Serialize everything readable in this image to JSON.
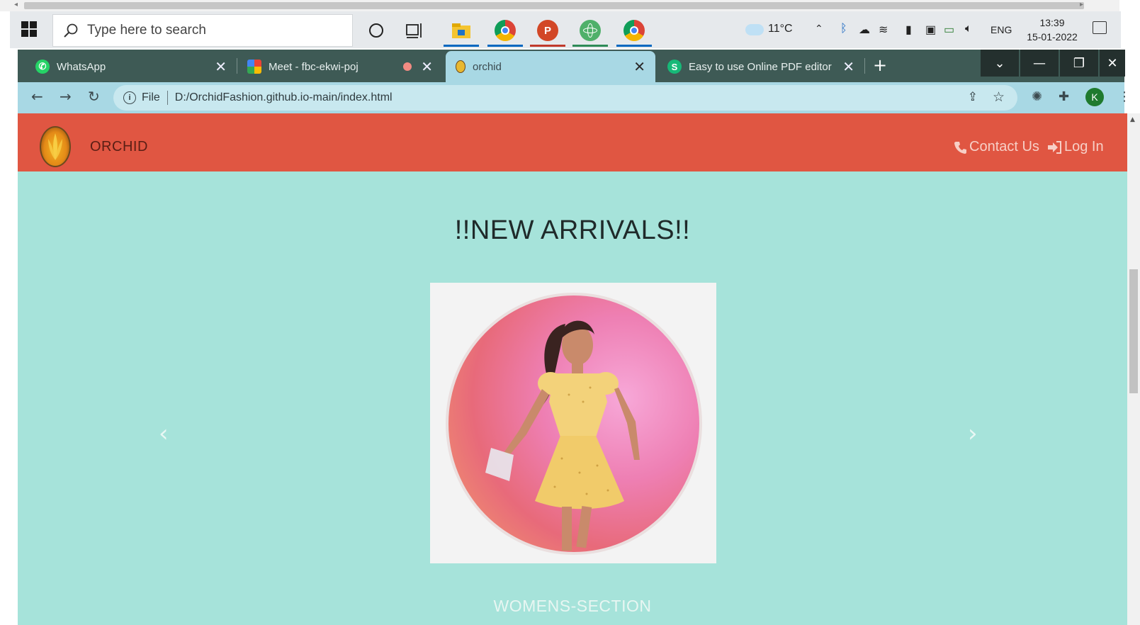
{
  "taskbar": {
    "search_placeholder": "Type here to search",
    "weather": "11°C",
    "language": "ENG",
    "time": "13:39",
    "date": "15-01-2022"
  },
  "browser": {
    "tabs": [
      {
        "label": "WhatsApp",
        "active": false
      },
      {
        "label": "Meet - fbc-ekwi-poj",
        "active": false
      },
      {
        "label": "orchid",
        "active": true
      },
      {
        "label": "Easy to use Online PDF editor",
        "active": false
      }
    ],
    "url_scheme": "File",
    "url": "D:/OrchidFashion.github.io-main/index.html",
    "profile_initial": "K"
  },
  "page": {
    "brand": "ORCHID",
    "nav": {
      "contact": "Contact Us",
      "login": "Log In"
    },
    "heading": "!!NEW ARRIVALS!!",
    "carousel": {
      "caption": "WOMENS-SECTION"
    }
  },
  "colors": {
    "navbar": "#e05642",
    "page_bg": "#a6e3da",
    "tab_strip": "#3e5a55",
    "active_tab": "#a8d8e4"
  }
}
